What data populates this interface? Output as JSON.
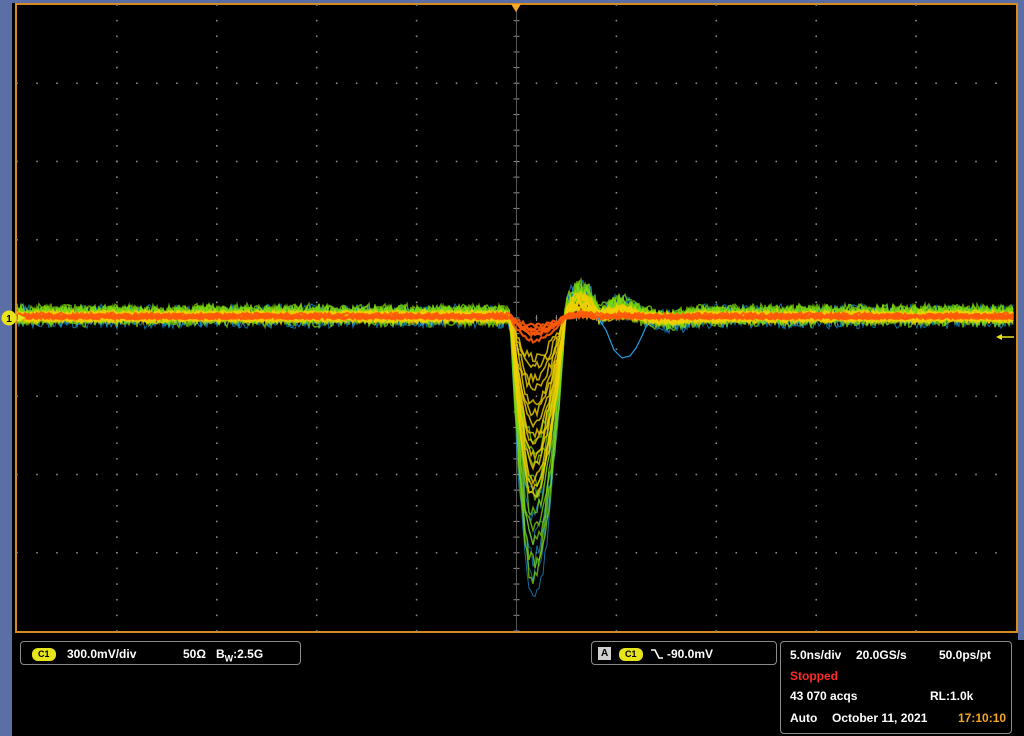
{
  "channel": {
    "id": "C1",
    "scale": "300.0mV/div",
    "coupling": "50Ω",
    "bandwidth_prefix": "B",
    "bandwidth_sub": "W",
    "bandwidth_value": ":2.5G",
    "marker": "1",
    "color": "#e8e41c"
  },
  "trigger": {
    "mode_box": "A",
    "source": "C1",
    "slope_icon": "falling-edge-icon",
    "level": "-90.0mV"
  },
  "timebase": {
    "time_div": "5.0ns/div",
    "sample_rate": "20.0GS/s",
    "resolution": "50.0ps/pt",
    "run_state": "Stopped",
    "acquisitions": "43 070 acqs",
    "record_length": "RL:1.0k",
    "trigger_mode": "Auto",
    "date": "October 11, 2021",
    "time": "17:10:10"
  },
  "colors": {
    "graticule_border": "#d98a1e",
    "bezel": "#5b6fa6",
    "persistence_hot": "#ff5a0a",
    "persistence_warm": "#f0d000",
    "persistence_mid": "#7dd80a",
    "persistence_cold": "#1e9ee0",
    "stopped": "#ff2a2a"
  }
}
